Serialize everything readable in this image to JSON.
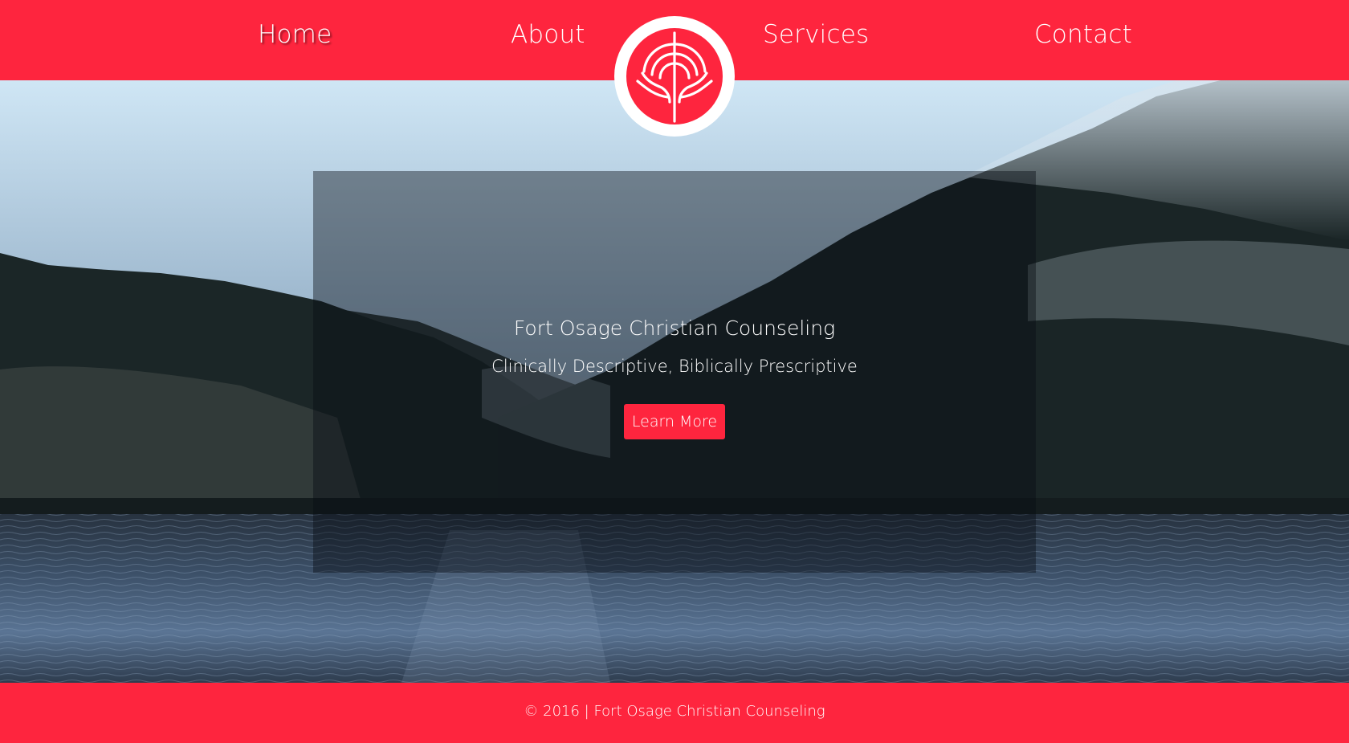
{
  "nav": {
    "home": "Home",
    "about": "About",
    "services": "Services",
    "contact": "Contact",
    "active": "home"
  },
  "logo": {
    "icon": "tree-of-life-icon"
  },
  "hero": {
    "title": "Fort Osage Christian Counseling",
    "subtitle": "Clinically Descriptive, Biblically Prescriptive",
    "button_label": "Learn More"
  },
  "footer": {
    "text": "© 2016 | Fort Osage Christian Counseling"
  },
  "colors": {
    "brand": "#fe253e",
    "text": "#ffffff",
    "overlay": "rgba(8, 12, 18, 0.42)"
  }
}
